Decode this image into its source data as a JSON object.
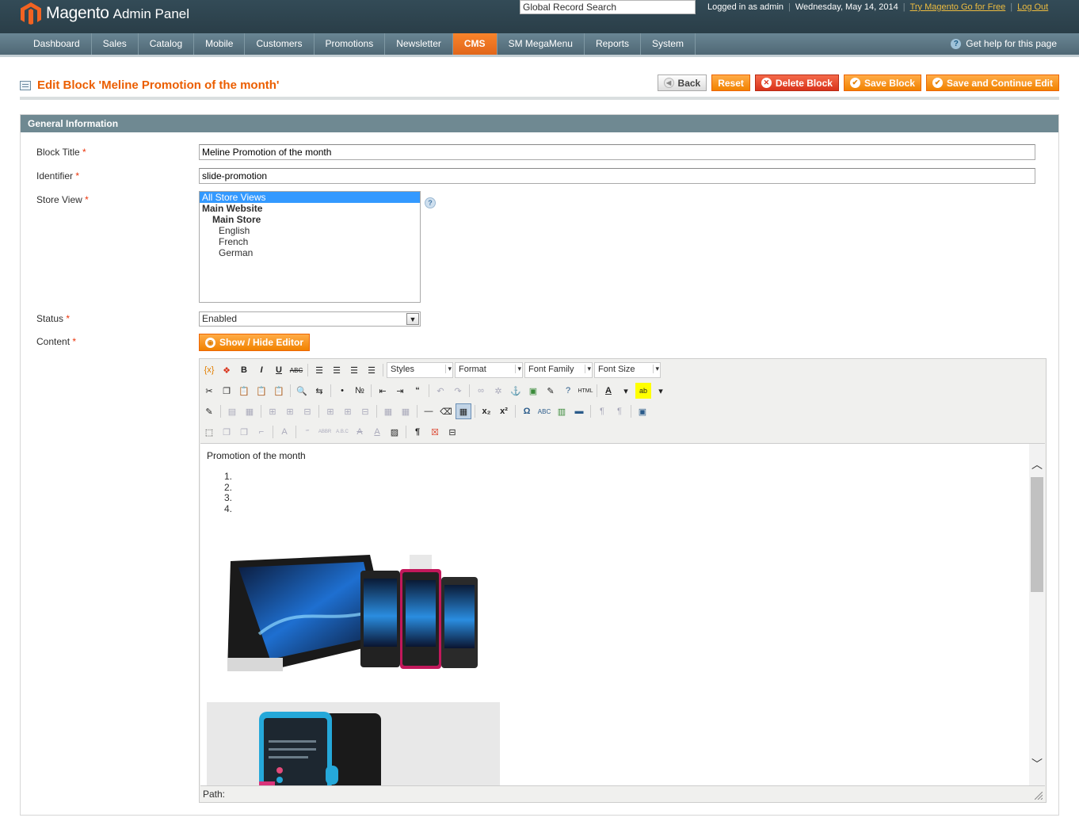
{
  "header": {
    "brand": "Magento",
    "subtitle": "Admin Panel",
    "search_value": "Global Record Search",
    "logged_in": "Logged in as admin",
    "date": "Wednesday, May 14, 2014",
    "try_link": "Try Magento Go for Free",
    "logout": "Log Out"
  },
  "nav": {
    "items": [
      "Dashboard",
      "Sales",
      "Catalog",
      "Mobile",
      "Customers",
      "Promotions",
      "Newsletter",
      "CMS",
      "SM MegaMenu",
      "Reports",
      "System"
    ],
    "active": "CMS",
    "help": "Get help for this page"
  },
  "page": {
    "title": "Edit Block 'Meline Promotion of the month'",
    "buttons": {
      "back": "Back",
      "reset": "Reset",
      "delete": "Delete Block",
      "save": "Save Block",
      "save_continue": "Save and Continue Edit"
    }
  },
  "form": {
    "section_title": "General Information",
    "block_title_label": "Block Title",
    "block_title_value": "Meline Promotion of the month",
    "identifier_label": "Identifier",
    "identifier_value": "slide-promotion",
    "store_view_label": "Store View",
    "store_options": {
      "all": "All Store Views",
      "website": "Main Website",
      "store": "Main Store",
      "english": "English",
      "french": "French",
      "german": "German"
    },
    "status_label": "Status",
    "status_value": "Enabled",
    "content_label": "Content",
    "required_mark": "*",
    "editor_toggle": "Show / Hide Editor"
  },
  "editor": {
    "dropdowns": {
      "styles": "Styles",
      "format": "Format",
      "font_family": "Font Family",
      "font_size": "Font Size"
    },
    "content_heading": "Promotion of the month",
    "list_items": [
      "1.",
      "2.",
      "3.",
      "4."
    ],
    "path_label": "Path:"
  },
  "colors": {
    "accent_orange": "#eb5e00",
    "header_bg": "#2e4450",
    "nav_bg": "#5e7a88",
    "section_head": "#6f8992"
  }
}
